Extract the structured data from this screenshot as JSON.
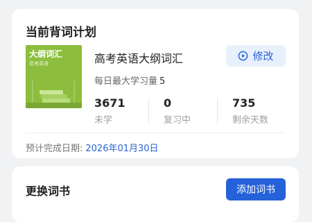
{
  "plan": {
    "title": "当前背词计划",
    "cover": {
      "title": "大纲词汇",
      "subtitle": "高考英语",
      "color": "#8cbd3c"
    },
    "book_name": "高考英语大纲词汇",
    "edit_label": "修改",
    "edit_icon": "play-circle-icon",
    "daily_label": "每日最大学习量",
    "daily_value": "5",
    "stats": [
      {
        "value": "3671",
        "label": "未学"
      },
      {
        "value": "0",
        "label": "复习中"
      },
      {
        "value": "735",
        "label": "剩余天数"
      }
    ],
    "finish_label": "预计完成日期:",
    "finish_date": "2026年01月30日"
  },
  "change": {
    "title": "更换词书",
    "add_label": "添加词书"
  },
  "colors": {
    "accent": "#2561d9",
    "accent_light": "#e8f0fc"
  }
}
